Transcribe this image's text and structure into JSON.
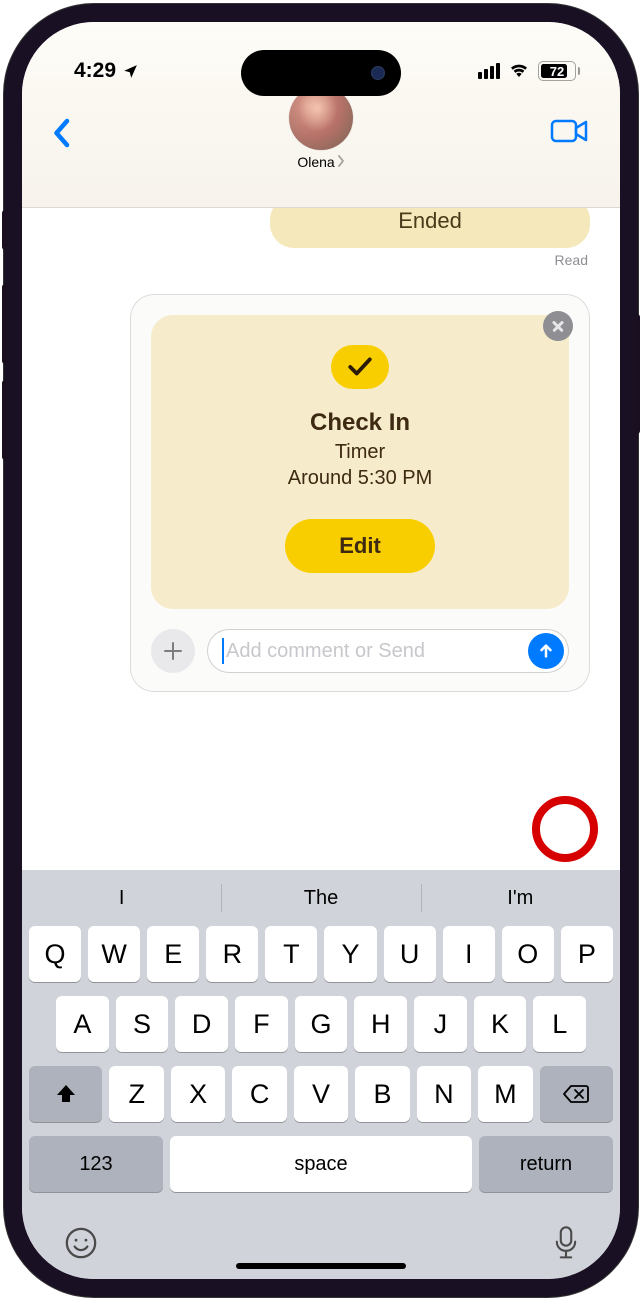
{
  "status": {
    "time": "4:29",
    "battery": "72"
  },
  "header": {
    "contact_name": "Olena"
  },
  "conversation": {
    "prev_bubble_text": "Ended",
    "read_receipt": "Read",
    "card": {
      "title": "Check In",
      "line1": "Timer",
      "line2": "Around 5:30 PM",
      "edit_label": "Edit"
    }
  },
  "input": {
    "placeholder": "Add comment or Send"
  },
  "keyboard": {
    "suggestions": [
      "I",
      "The",
      "I'm"
    ],
    "row1": [
      "Q",
      "W",
      "E",
      "R",
      "T",
      "Y",
      "U",
      "I",
      "O",
      "P"
    ],
    "row2": [
      "A",
      "S",
      "D",
      "F",
      "G",
      "H",
      "J",
      "K",
      "L"
    ],
    "row3": [
      "Z",
      "X",
      "C",
      "V",
      "B",
      "N",
      "M"
    ],
    "numbers_label": "123",
    "space_label": "space",
    "return_label": "return"
  }
}
